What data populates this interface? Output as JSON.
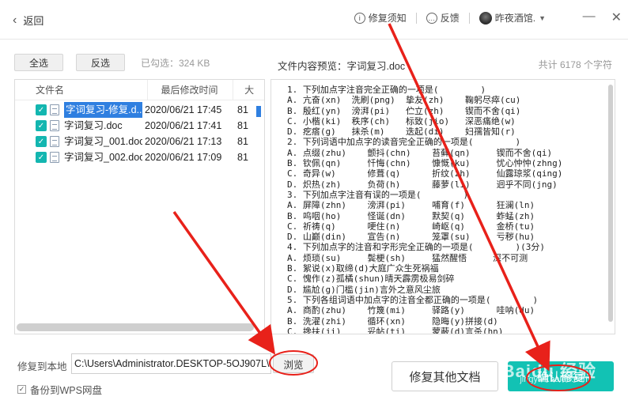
{
  "header": {
    "back_label": "返回",
    "help_label": "修复须知",
    "feedback_label": "反馈",
    "user_name": "昨夜酒馆.",
    "minimize_glyph": "—",
    "close_glyph": "✕"
  },
  "toolbar": {
    "select_all": "全选",
    "invert": "反选",
    "selected_info": "已勾选：324 KB"
  },
  "file_list": {
    "headers": [
      "文件名",
      "最后修改时间",
      "大"
    ],
    "rows": [
      {
        "name": "字词复习-修复.d...",
        "time": "2020/06/21 17:45",
        "size": "81",
        "selected": true,
        "checked": true
      },
      {
        "name": "字词复习.doc",
        "time": "2020/06/21 17:41",
        "size": "81",
        "selected": false,
        "checked": true
      },
      {
        "name": "字词复习_001.doc",
        "time": "2020/06/21 17:13",
        "size": "81",
        "selected": false,
        "checked": true
      },
      {
        "name": "字词复习_002.doc",
        "time": "2020/06/21 17:09",
        "size": "81",
        "selected": false,
        "checked": true
      }
    ]
  },
  "preview": {
    "title": "文件内容预览：字词复习.doc",
    "total": "共计 6178 个字符",
    "lines": [
      "1. 下列加点字注音完全正确的一项是(        )",
      "A. 亢奋(xn)  洗刷(png)  挚友(zh)    鞠躬尽瘁(cu)",
      "B. 殷红(yn)  滂湃(pi)   伫立(zh)    锲而不舍(qi)",
      "C. 小楷(ki)  秩序(ch)   标致(jio)   深恶痛绝(w)",
      "D. 疙瘩(g)   抹杀(m)    迭起(di)    妇孺皆知(r)",
      "2. 下列词语中加点字的读音完全正确的一项是(        )",
      "A. 点缀(zhu)    颤抖(chn)    苔藓(qn)     锲而不舍(qi)",
      "B. 钦佩(qn)     忏悔(chn)    慷慨(ku)     忧心忡忡(zhng)",
      "C. 奇异(w)      修葺(q)      折纹(zh)     仙露琼浆(qing)",
      "D. 炽热(zh)     负荷(h)      藤萝(li)     迥乎不同(jng)",
      "3. 下列加点字注音有误的一项是(        )",
      "A. 屏障(zhn)    滂湃(pi)     哺育(f)      狂澜(ln)",
      "B. 呜咽(ho)     怪诞(dn)     默契(q)      蚱蜢(zh)",
      "C. 祈祷(q)      哽住(n)      崎岖(q)      金桥(tu)",
      "D. 山巅(din)    宣告(n)      笼罩(su)     亏秽(hu)",
      "4. 下列加点字的注音和字形完全正确的一项是(        )(3分)",
      "A. 烦琐(su)     鬓梗(sh)     猛然醒悟     深不可测",
      "B. 絮说(x)取缔(d)大庭广众生死祸福",
      "C. 愧作(z)孤橘(shun)晴天霹雳极易剑碎",
      "D. 尴尬(g)门槛(jin)言外之意风尘旅",
      "5. 下列各组词语中加点字的注音全都正确的一项是(        )",
      "A. 商酌(zhu)    竹篾(mi)     驿路(y)      哇呐(du)",
      "B. 洗濯(zhi)    循环(xn)     隐晦(y)拼接(d)",
      "C. 搀扶(ji)     妥帖(ti)     蒙蔽(d)言杀(hn)",
      "D. 打拚(gng)丁卯(mo)陷补(pi)揖首(t)"
    ]
  },
  "bottom": {
    "restore_to_label": "修复到本地",
    "path_value": "C:\\Users\\Administrator.DESKTOP-5OJ907L\\",
    "browse_label": "浏览",
    "backup_label": "备份到WPS网盘",
    "restore_other_label": "修复其他文档",
    "confirm_label": "确认修复"
  },
  "watermark": {
    "brand": "Baidu 经验",
    "url": "jingyan.baidu.com"
  },
  "colors": {
    "accent": "#12c2b4",
    "selection": "#2f7fe0",
    "annotation": "#e8211a"
  }
}
